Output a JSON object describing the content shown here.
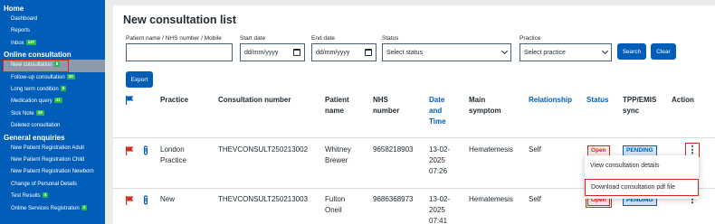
{
  "sidebar": {
    "home_label": "Home",
    "home_items": [
      {
        "label": "Dashboard",
        "badge": ""
      },
      {
        "label": "Reports",
        "badge": ""
      },
      {
        "label": "Inbox",
        "badge": "137"
      }
    ],
    "online_label": "Online consultation",
    "online_items": [
      {
        "label": "New consultation",
        "badge": "8"
      },
      {
        "label": "Follow-up consultation",
        "badge": "20"
      },
      {
        "label": "Long term condition",
        "badge": "5"
      },
      {
        "label": "Medication query",
        "badge": "41"
      },
      {
        "label": "Sick Note",
        "badge": "19"
      },
      {
        "label": "Deleted consultation",
        "badge": ""
      }
    ],
    "general_label": "General enquiries",
    "general_items": [
      {
        "label": "New Patient Registration Adult",
        "badge": ""
      },
      {
        "label": "New Patient Registration Child",
        "badge": ""
      },
      {
        "label": "New Patient Registration Newborn",
        "badge": ""
      },
      {
        "label": "Change of Personal Details",
        "badge": ""
      },
      {
        "label": "Test Results",
        "badge": "4"
      },
      {
        "label": "Online Services Registration",
        "badge": "2"
      }
    ]
  },
  "page": {
    "title": "New consultation list"
  },
  "filters": {
    "patient_label": "Patient name / NHS number / Mobile",
    "patient_value": "",
    "start_label": "Start date",
    "start_value": "dd/mm/yyyy",
    "end_label": "End date",
    "end_value": "dd/mm/yyyy",
    "status_label": "Status",
    "status_value": "Select status",
    "practice_label": "Practice",
    "practice_value": "Select practice",
    "search_label": "Search",
    "clear_label": "Clear",
    "export_label": "Export"
  },
  "table": {
    "headers": {
      "practice": "Practice",
      "consultation_number": "Consultation number",
      "patient_name_1": "Patient",
      "patient_name_2": "name",
      "nhs_1": "NHS",
      "nhs_2": "number",
      "date_1": "Date",
      "date_2": "and",
      "date_3": "Time",
      "symptom_1": "Main",
      "symptom_2": "symptom",
      "relationship": "Relationship",
      "status": "Status",
      "tpp_1": "TPP/EMIS",
      "tpp_2": "sync",
      "action": "Action"
    },
    "rows": [
      {
        "practice_1": "London",
        "practice_2": "Practice",
        "consultation_number": "THEVCONSULT250213002",
        "patient_1": "Whitney",
        "patient_2": "Brewer",
        "nhs": "9658218903",
        "date_1": "13-02-",
        "date_2": "2025",
        "date_3": "07:26",
        "symptom": "Hematemesis",
        "relationship": "Self",
        "status": "Open",
        "sync": "PENDING",
        "action_icon": "kebab-menu-icon"
      },
      {
        "practice_1": "New",
        "practice_2": "",
        "consultation_number": "THEVCONSULT250213003",
        "patient_1": "Fulton",
        "patient_2": "Oneil",
        "nhs": "9686368973",
        "date_1": "13-02-",
        "date_2": "2025",
        "date_3": "07:41",
        "symptom": "Hematemesis",
        "relationship": "Self",
        "status": "Open",
        "sync": "PENDING",
        "action_icon": "kebab-menu-icon"
      }
    ]
  },
  "action_menu": {
    "view_label": "View consultation details",
    "download_label": "Download consultation pdf file"
  },
  "colors": {
    "sidebar_bg": "#005eb8",
    "accent": "#005eb8",
    "flag_red": "#d5281b",
    "badge_green": "#2db84b",
    "highlight_outline": "#d5281b"
  }
}
